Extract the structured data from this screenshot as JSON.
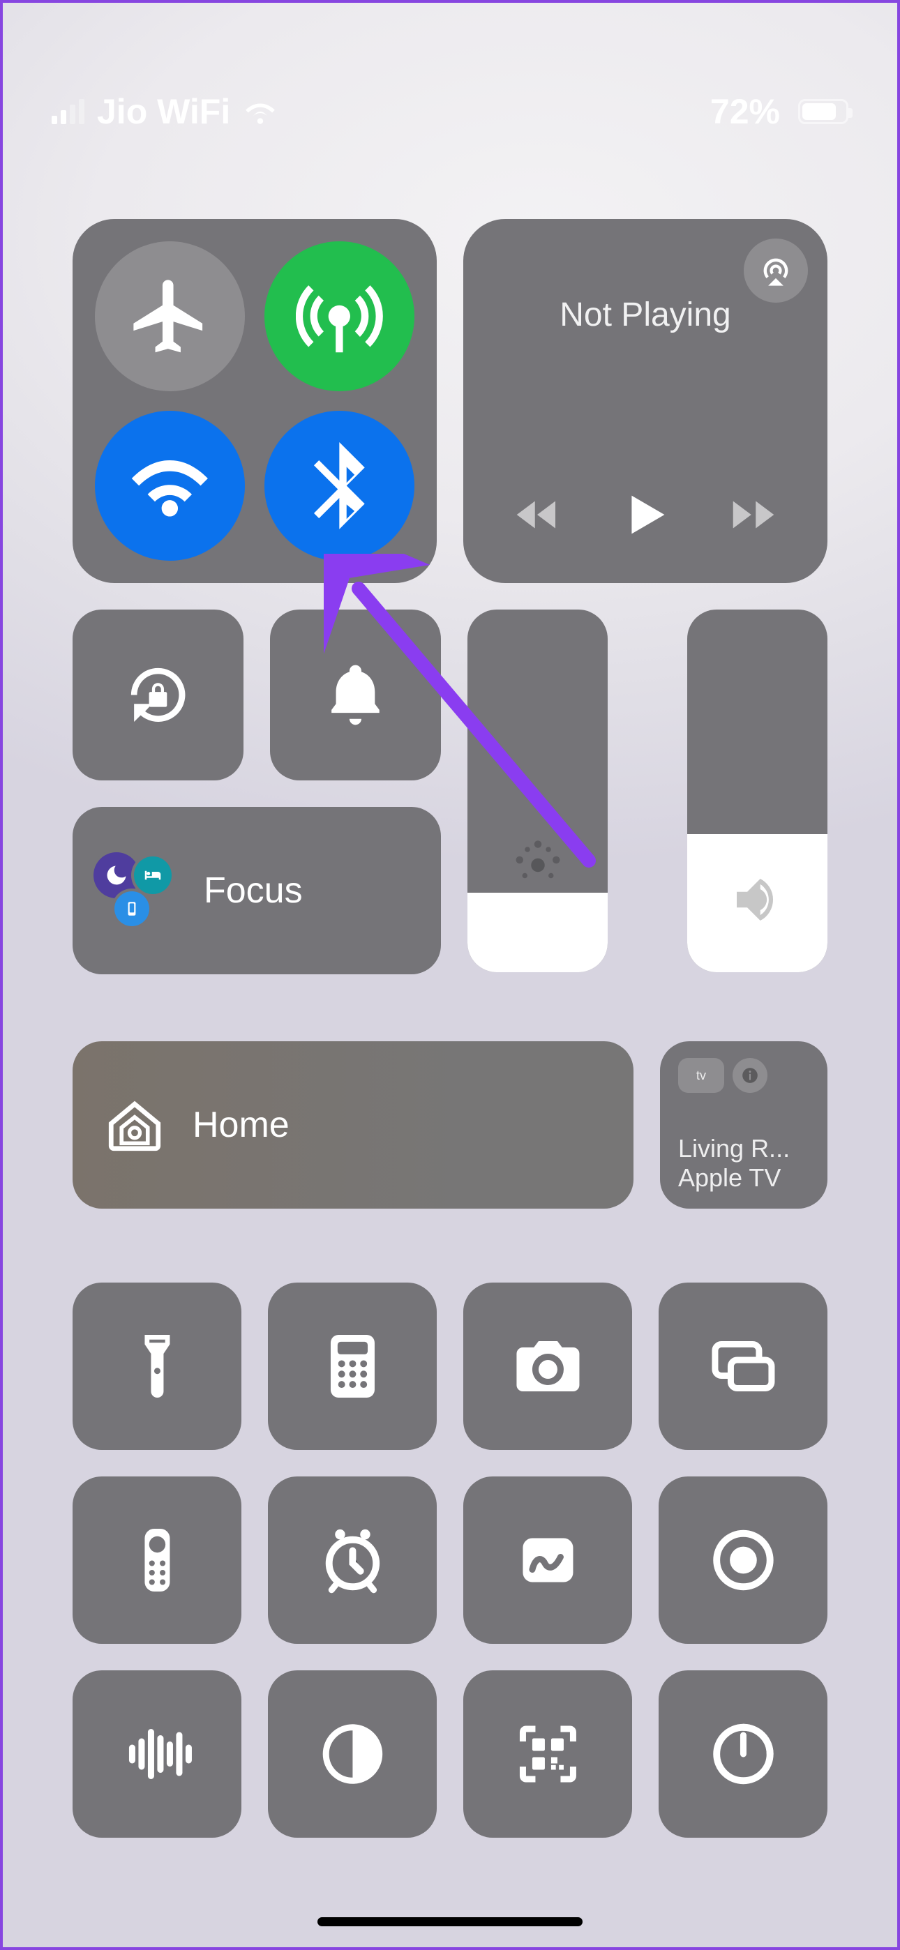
{
  "status": {
    "carrier": "Jio WiFi",
    "battery_percent": 72,
    "battery_label": "72%",
    "signal_active_bars": 2
  },
  "connectivity": {
    "airplane": {
      "on": false
    },
    "cellular": {
      "on": true
    },
    "wifi": {
      "on": true
    },
    "bluetooth": {
      "on": true
    }
  },
  "media": {
    "title": "Not Playing"
  },
  "focus": {
    "label": "Focus"
  },
  "home": {
    "label": "Home"
  },
  "remote": {
    "badge": "tv",
    "line1": "Living R...",
    "line2": "Apple TV"
  },
  "sliders": {
    "brightness_percent": 22,
    "volume_percent": 38
  },
  "tiles": [
    "flashlight",
    "calculator",
    "camera",
    "screen-mirroring",
    "apple-tv-remote",
    "alarm",
    "freeform",
    "screen-record",
    "sound-recognition",
    "dark-mode",
    "qr-scan",
    "timer"
  ]
}
